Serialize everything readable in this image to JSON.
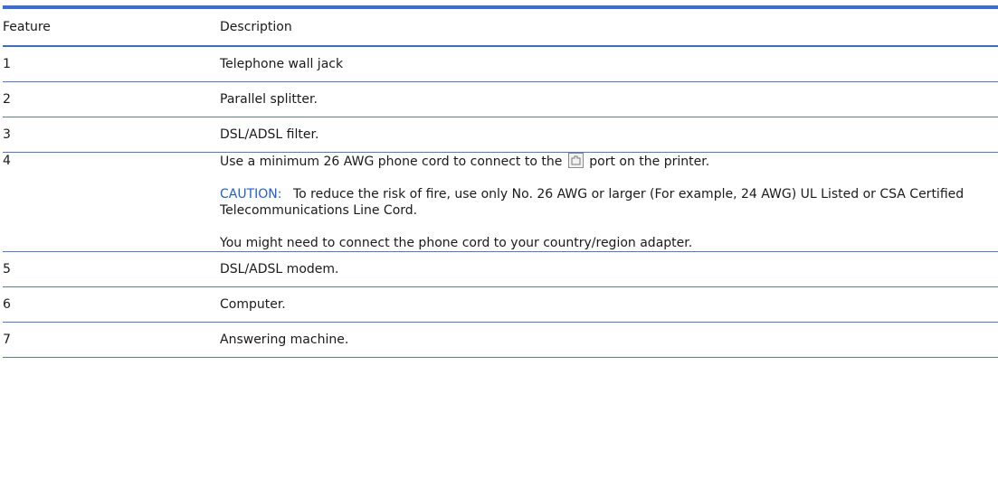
{
  "table": {
    "headers": [
      "Feature",
      "Description"
    ],
    "rows": [
      {
        "feature": "1",
        "description": "Telephone wall jack"
      },
      {
        "feature": "2",
        "description": "Parallel splitter."
      },
      {
        "feature": "3",
        "description": "DSL/ADSL filter."
      },
      {
        "feature": "4",
        "desc_part1": "Use a minimum 26 AWG phone cord to connect to the",
        "port_icon": "phone-port-icon",
        "desc_part2": "port on the printer.",
        "caution_label": "CAUTION:",
        "caution_text": "To reduce the risk of fire, use only No. 26 AWG or larger (For example, 24 AWG) UL Listed or CSA Certified Telecommunications Line Cord.",
        "note": "You might need to connect the phone cord to your country/region adapter."
      },
      {
        "feature": "5",
        "description": "DSL/ADSL modem."
      },
      {
        "feature": "6",
        "description": "Computer."
      },
      {
        "feature": "7",
        "description": "Answering machine."
      }
    ]
  },
  "colors": {
    "rule": "#3b6bd6",
    "caution": "#1f5fd6"
  }
}
